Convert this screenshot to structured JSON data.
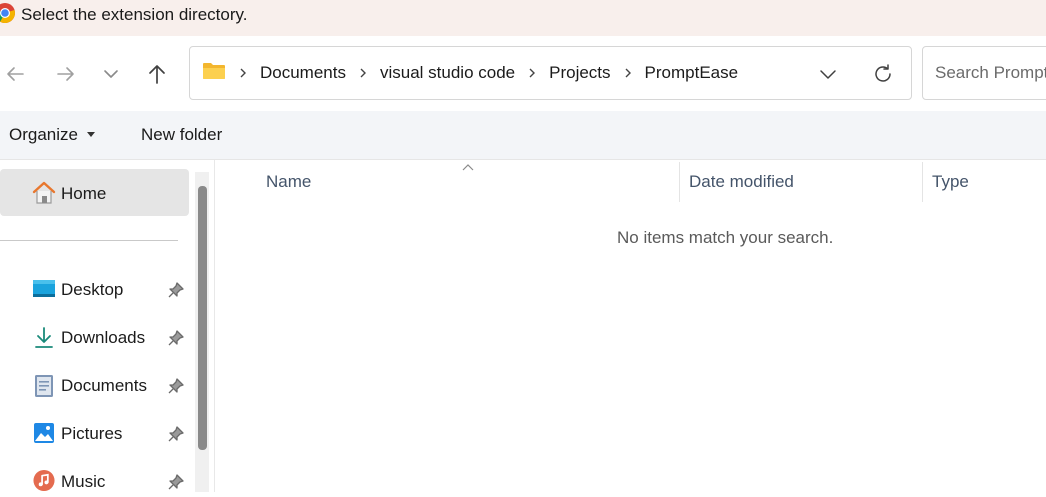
{
  "window": {
    "title": "Select the extension directory."
  },
  "address": {
    "crumbs": [
      "Documents",
      "visual studio code",
      "Projects",
      "PromptEase"
    ]
  },
  "search": {
    "placeholder": "Search PromptEase"
  },
  "toolbar": {
    "organize_label": "Organize",
    "new_folder_label": "New folder"
  },
  "sidebar": {
    "home_label": "Home",
    "items": [
      {
        "label": "Desktop",
        "icon": "desktop-icon"
      },
      {
        "label": "Downloads",
        "icon": "downloads-icon"
      },
      {
        "label": "Documents",
        "icon": "documents-icon"
      },
      {
        "label": "Pictures",
        "icon": "pictures-icon"
      },
      {
        "label": "Music",
        "icon": "music-icon"
      }
    ]
  },
  "columns": {
    "name": "Name",
    "date_modified": "Date modified",
    "type": "Type"
  },
  "content": {
    "empty_message": "No items match your search."
  },
  "colors": {
    "titlebar_bg": "#f8efec",
    "commandbar_bg": "#f3f5f8",
    "selected_bg": "#e5e5e5",
    "header_text": "#44546a"
  }
}
